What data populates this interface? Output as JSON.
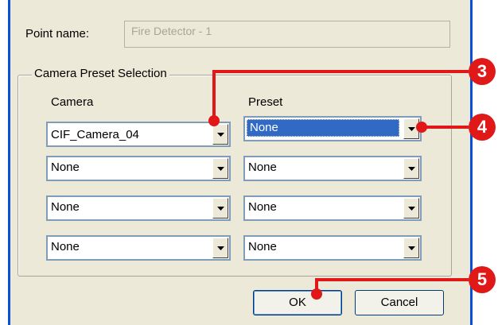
{
  "point_name": {
    "label": "Point name:",
    "value": "Fire Detector - 1"
  },
  "group": {
    "title": "Camera Preset Selection"
  },
  "columns": {
    "camera": "Camera",
    "preset": "Preset"
  },
  "rows": [
    {
      "camera": "CIF_Camera_04",
      "preset": "None"
    },
    {
      "camera": "None",
      "preset": "None"
    },
    {
      "camera": "None",
      "preset": "None"
    },
    {
      "camera": "None",
      "preset": "None"
    }
  ],
  "buttons": {
    "ok": "OK",
    "cancel": "Cancel"
  },
  "callouts": {
    "c3": "3",
    "c4": "4",
    "c5": "5"
  },
  "colors": {
    "callout": "#e01818",
    "selection": "#316ac5",
    "window_border": "#0a4fd6"
  },
  "icons": [
    "chevron-down-icon"
  ]
}
